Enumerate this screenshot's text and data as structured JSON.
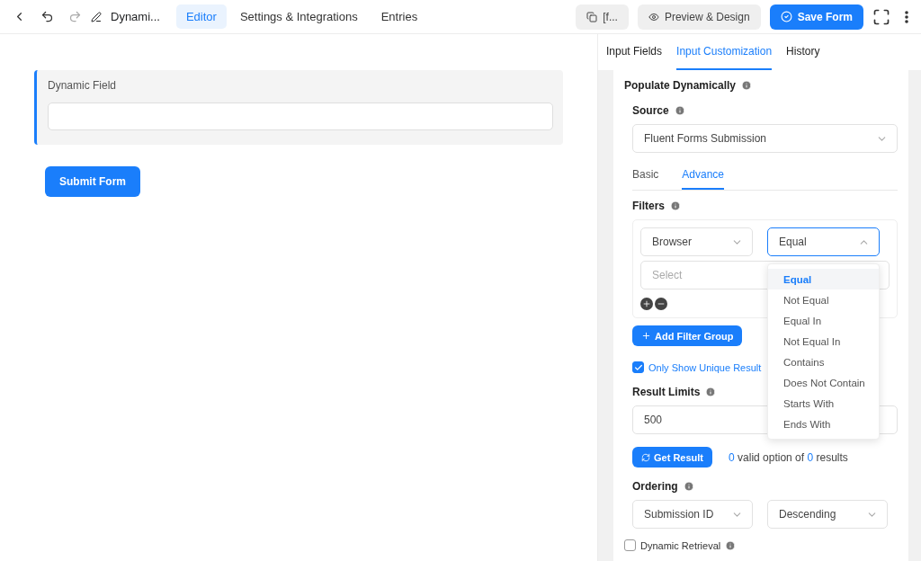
{
  "topbar": {
    "title": "Dynami...",
    "tabs": [
      {
        "label": "Editor",
        "selected": true
      },
      {
        "label": "Settings & Integrations",
        "selected": false
      },
      {
        "label": "Entries",
        "selected": false
      }
    ],
    "shortcode": "[f...",
    "preview": "Preview & Design",
    "save": "Save Form"
  },
  "form": {
    "field_label": "Dynamic Field",
    "submit": "Submit Form"
  },
  "panel": {
    "tabs": [
      {
        "label": "Input Fields",
        "selected": false
      },
      {
        "label": "Input Customization",
        "selected": true
      },
      {
        "label": "History",
        "selected": false
      }
    ],
    "section_title": "Populate Dynamically",
    "source_label": "Source",
    "source_value": "Fluent Forms Submission",
    "subtabs": [
      {
        "label": "Basic",
        "selected": false
      },
      {
        "label": "Advance",
        "selected": true
      }
    ],
    "filters_label": "Filters",
    "filter": {
      "field": "Browser",
      "operator": "Equal",
      "open": true,
      "value_placeholder": "Select"
    },
    "operator_options": [
      {
        "label": "Equal",
        "selected": true
      },
      {
        "label": "Not Equal",
        "selected": false
      },
      {
        "label": "Equal In",
        "selected": false
      },
      {
        "label": "Not Equal In",
        "selected": false
      },
      {
        "label": "Contains",
        "selected": false
      },
      {
        "label": "Does Not Contain",
        "selected": false
      },
      {
        "label": "Starts With",
        "selected": false
      },
      {
        "label": "Ends With",
        "selected": false
      }
    ],
    "add_filter_group": "Add Filter Group",
    "unique": {
      "label": "Only Show Unique Result",
      "checked": true
    },
    "limits_label": "Result Limits",
    "limits_value": "500",
    "get_result": "Get Result",
    "result": {
      "valid": "0",
      "text": "valid option of",
      "total": "0",
      "suffix": "results"
    },
    "ordering_label": "Ordering",
    "ordering_by": "Submission ID",
    "ordering_dir": "Descending",
    "dynamic_retrieval": {
      "label": "Dynamic Retrieval",
      "checked": false
    }
  }
}
